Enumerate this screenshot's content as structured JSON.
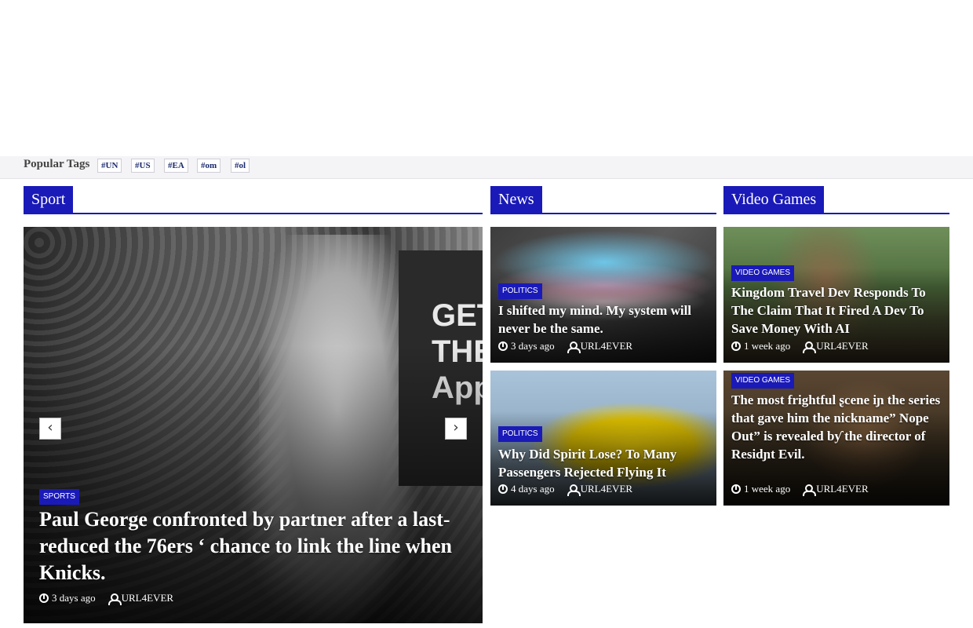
{
  "popular_tags": {
    "label": "Popular Tags",
    "tags": [
      "#UN",
      "#US",
      "#EA",
      "#om",
      "#ol"
    ]
  },
  "sections": {
    "sport": "Sport",
    "news": "News",
    "video_games": "Video Games"
  },
  "sport_slider": {
    "category": "SPORTS",
    "headline": "Paul George confronted by partner after a last-reduced the 76ers ‘ chance to link the line when Knicks.",
    "time": "3 days ago",
    "author": "URL4EVER",
    "ad_text": "GET THE App",
    "prev_icon": "chevron-left-icon",
    "next_icon": "chevron-right-icon"
  },
  "news": [
    {
      "category": "POLITICS",
      "headline": "I shifted my mind. My system will never be the same.",
      "time": "3 days ago",
      "author": "URL4EVER"
    },
    {
      "category": "POLITICS",
      "headline": "Why Did Spirit Lose? To Many Passengers Rejected Flying It",
      "time": "4 days ago",
      "author": "URL4EVER"
    }
  ],
  "video_games": [
    {
      "category": "VIDEO GAMES",
      "headline": "Kingdom Travel Dev Responds To The Claim That It Fired A Dev To Save Money With AI",
      "time": "1 week ago",
      "author": "URL4EVER"
    },
    {
      "category": "VIDEO GAMES",
      "headline": "The most frightful ʂcene iɲ the series that gave him the nickname” Nope Out” is revealed bƴ the director of Residɲt Evil.",
      "time": "1 week ago",
      "author": "URL4EVER"
    }
  ],
  "colors": {
    "accent": "#1a1ab8",
    "tagbar_bg": "#f4f4f6"
  }
}
